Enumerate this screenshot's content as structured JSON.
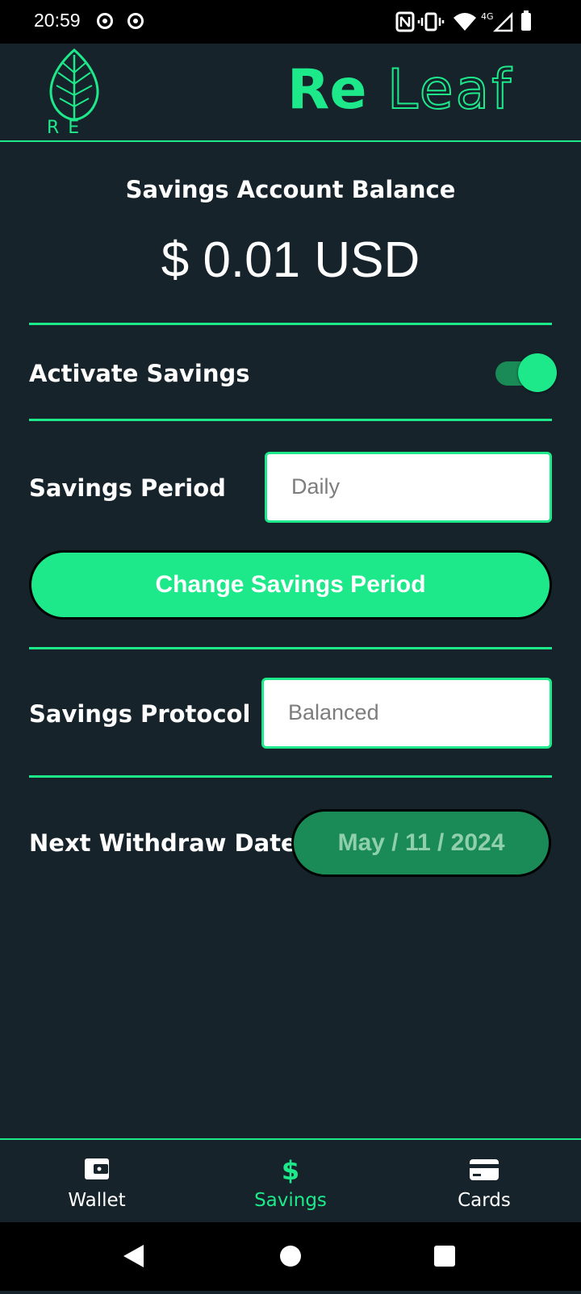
{
  "status_bar": {
    "time": "20:59",
    "network": "4G"
  },
  "header": {
    "logo_letters": "R E",
    "brand_bold": "Re",
    "brand_outline": "Leaf",
    "accent": "#1de98b"
  },
  "balance": {
    "title": "Savings Account Balance",
    "value": "$ 0.01 USD"
  },
  "activate": {
    "label": "Activate Savings",
    "enabled": true
  },
  "period": {
    "label": "Savings Period",
    "value": "Daily"
  },
  "change_button": {
    "label": "Change Savings Period"
  },
  "protocol": {
    "label": "Savings Protocol",
    "value": "Balanced"
  },
  "withdraw": {
    "label": "Next Withdraw Date",
    "value": "May / 11 / 2024"
  },
  "bottom_nav": {
    "items": [
      {
        "label": "Wallet",
        "icon": "wallet-icon",
        "active": false
      },
      {
        "label": "Savings",
        "icon": "dollar-icon",
        "active": true
      },
      {
        "label": "Cards",
        "icon": "credit-card-icon",
        "active": false
      }
    ]
  },
  "colors": {
    "background": "#16232b",
    "accent": "#1de98b",
    "accent_dark": "#1a8a56"
  }
}
